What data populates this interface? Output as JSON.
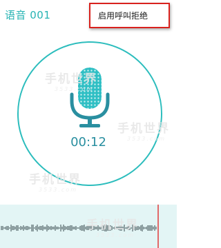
{
  "recording": {
    "title": "语音 001",
    "elapsed": "00:12"
  },
  "menu": {
    "items": [
      {
        "label": "启用呼叫拒绝"
      }
    ]
  },
  "watermark": {
    "brand": "手机世界",
    "domain": "3533.com"
  },
  "icons": {
    "mic": "microphone-icon"
  },
  "colors": {
    "accent": "#26b3b3",
    "circle": "#2cbdbd",
    "mic_body": "#2fbfc4",
    "mic_stand": "#2a8fa0",
    "highlight_border": "#d9211d",
    "wave_bg": "#e3f5f5",
    "playhead": "#e23a3a"
  }
}
